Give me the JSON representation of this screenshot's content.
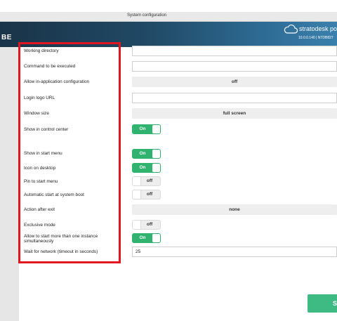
{
  "window": {
    "title": "System configuration"
  },
  "header": {
    "brand_left": "BE",
    "product": "stratodesk po",
    "version": "10.0.0.140 | NTDB827"
  },
  "fields": {
    "working_directory": {
      "label": "Working directory",
      "value": ""
    },
    "command": {
      "label": "Command to be executed",
      "value": ""
    },
    "in_app_config": {
      "label": "Allow in-application configuration",
      "value": "off"
    },
    "login_logo_url": {
      "label": "Login logo URL",
      "value": ""
    },
    "window_size": {
      "label": "Window size",
      "value": "full screen"
    },
    "show_control_center": {
      "label": "Show in control center",
      "state": "On"
    },
    "show_start_menu": {
      "label": "Show in start menu",
      "state": "On"
    },
    "icon_desktop": {
      "label": "Icon on desktop",
      "state": "On"
    },
    "pin_start": {
      "label": "Pin to start menu",
      "state": "off"
    },
    "autostart": {
      "label": "Automatic start at system boot",
      "state": "off"
    },
    "action_after_exit": {
      "label": "Action after exit",
      "value": "none"
    },
    "exclusive_mode": {
      "label": "Exclusive mode",
      "state": "off"
    },
    "multi_instance": {
      "label": "Allow to start more than one instance simultaneously",
      "state": "On"
    },
    "wait_network": {
      "label": "Wait for network (timeout in seconds)",
      "value": "25"
    }
  },
  "footer": {
    "save_label": "Sav"
  },
  "colors": {
    "toggle_on": "#2fb36f",
    "highlight": "#e2161f",
    "save": "#3dbb82",
    "header": "#214a66"
  }
}
